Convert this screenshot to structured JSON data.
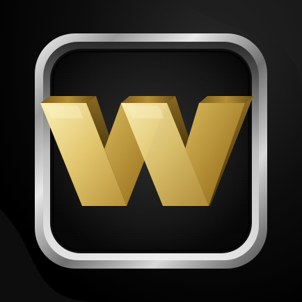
{
  "app_icon": {
    "glyph": "W",
    "colors": {
      "background": "#000000",
      "frame_light": "#f2f2f2",
      "frame_dark": "#3a3a3a",
      "inner_panel": "#1b1b1b",
      "gold_light": "#f3e3a3",
      "gold_mid": "#c9a545",
      "gold_dark": "#6e5417"
    }
  }
}
